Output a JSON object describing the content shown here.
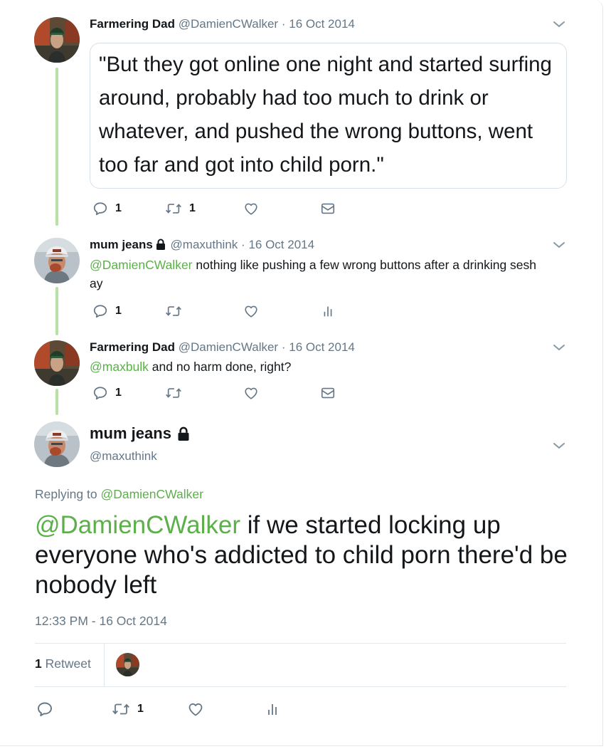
{
  "colors": {
    "link": "#5bb04a",
    "thread": "#b6e3a4",
    "muted": "#657786",
    "text": "#14171a"
  },
  "tweets": [
    {
      "name": "Farmering Dad",
      "handle": "@DamienCWalker",
      "separator": "·",
      "date": "16 Oct 2014",
      "quote": "\"But they got online one night and started surfing around, probably had too much to drink or whatever, and pushed the wrong buttons, went too far and got into child porn.\"",
      "reply_count": "1",
      "retweet_count": "1",
      "icons": [
        "reply-icon",
        "retweet-icon",
        "like-icon",
        "message-icon"
      ]
    },
    {
      "name": "mum jeans",
      "handle": "@maxuthink",
      "separator": "·",
      "date": "16 Oct 2014",
      "mention": "@DamienCWalker",
      "text": " nothing like pushing a few wrong buttons after a drinking sesh ay",
      "reply_count": "1",
      "icons": [
        "reply-icon",
        "retweet-icon",
        "like-icon",
        "analytics-icon"
      ]
    },
    {
      "name": "Farmering Dad",
      "handle": "@DamienCWalker",
      "separator": "·",
      "date": "16 Oct 2014",
      "mention": "@maxbulk",
      "text": " and no harm done, right?",
      "reply_count": "1",
      "icons": [
        "reply-icon",
        "retweet-icon",
        "like-icon",
        "message-icon"
      ]
    }
  ],
  "main_tweet": {
    "name": "mum jeans",
    "handle": "@maxuthink",
    "replying_label": "Replying to",
    "replying_handle": "@DamienCWalker",
    "mention": "@DamienCWalker",
    "text": " if we started locking up everyone who's addicted to child porn there'd be nobody left",
    "timestamp": "12:33 PM - 16 Oct 2014",
    "retweets_count": "1",
    "retweets_label": "Retweet",
    "retweet_action_count": "1",
    "icons": [
      "reply-icon",
      "retweet-icon",
      "like-icon",
      "analytics-icon"
    ]
  }
}
